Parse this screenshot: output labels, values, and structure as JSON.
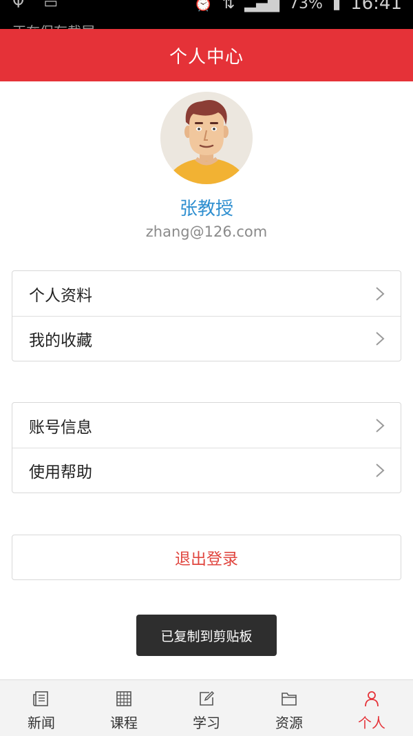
{
  "status_bar": {
    "notice": "正在保存截屏",
    "battery": "73%",
    "time": "16:41"
  },
  "header": {
    "title": "个人中心"
  },
  "profile": {
    "name": "张教授",
    "email": "zhang@126.com"
  },
  "menu_groups": [
    {
      "items": [
        {
          "label": "个人资料"
        },
        {
          "label": "我的收藏"
        }
      ]
    },
    {
      "items": [
        {
          "label": "账号信息"
        },
        {
          "label": "使用帮助"
        }
      ]
    }
  ],
  "logout": {
    "label": "退出登录"
  },
  "toast": {
    "text": "已复制到剪贴板"
  },
  "tabs": [
    {
      "label": "新闻",
      "icon": "news-icon",
      "active": false
    },
    {
      "label": "课程",
      "icon": "course-grid-icon",
      "active": false
    },
    {
      "label": "学习",
      "icon": "edit-icon",
      "active": false
    },
    {
      "label": "资源",
      "icon": "folder-icon",
      "active": false
    },
    {
      "label": "个人",
      "icon": "person-icon",
      "active": true
    }
  ],
  "colors": {
    "accent": "#e53238",
    "name": "#2f8fd0",
    "email": "#8a8a8a",
    "logout": "#e0463f",
    "active_tab": "#e53238"
  }
}
